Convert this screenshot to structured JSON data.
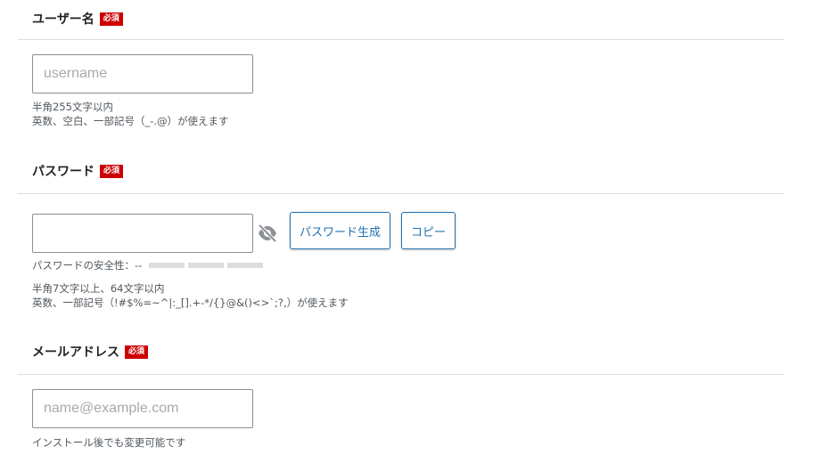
{
  "required_label": "必須",
  "username": {
    "title": "ユーザー名",
    "placeholder": "username",
    "help_line1": "半角255文字以内",
    "help_line2": "英数、空白、一部記号（_-.@）が使えます"
  },
  "password": {
    "title": "パスワード",
    "value": "",
    "generate_label": "パスワード生成",
    "copy_label": "コピー",
    "strength_label": "パスワードの安全性：--",
    "help_line1": "半角7文字以上、64文字以内",
    "help_line2": "英数、一部記号（!#$%=~^|:_[].+-*/{}@&()<>`;?,）が使えます",
    "visibility_icon": "eye-slash-icon"
  },
  "email": {
    "title": "メールアドレス",
    "placeholder": "name@example.com",
    "help_line1": "インストール後でも変更可能です"
  },
  "colors": {
    "required_badge": "#cc0000",
    "button_accent": "#2271b1",
    "divider": "#dcdcdc"
  }
}
